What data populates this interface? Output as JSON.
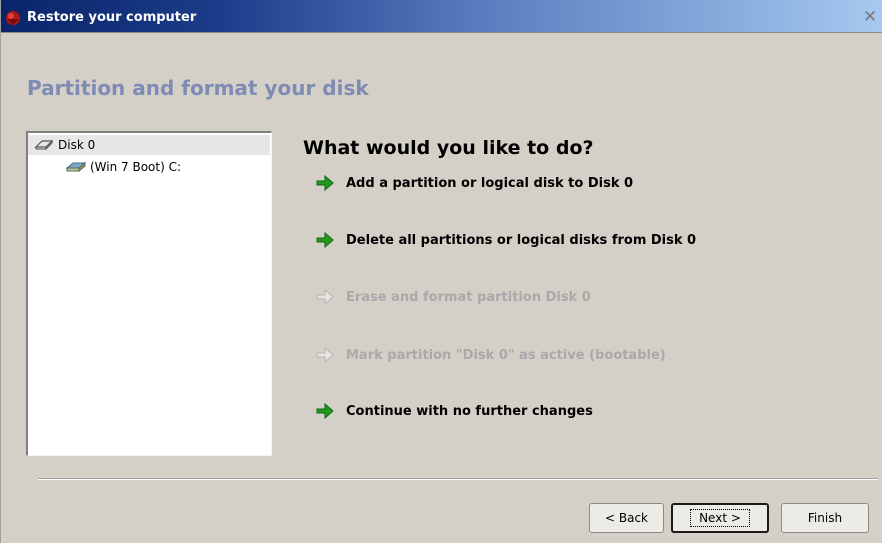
{
  "window": {
    "title": "Restore your computer",
    "close_glyph": "✕"
  },
  "page": {
    "title": "Partition and format your disk",
    "question": "What would you like to do?"
  },
  "tree": {
    "items": [
      {
        "label": "Disk 0",
        "icon": "disk-icon",
        "selected": true
      },
      {
        "label": "(Win 7 Boot) C:",
        "icon": "partition-icon",
        "selected": false
      }
    ]
  },
  "options": [
    {
      "label": "Add a partition or logical disk to Disk 0",
      "enabled": true
    },
    {
      "label": "Delete all partitions or logical disks from Disk 0",
      "enabled": true
    },
    {
      "label": "Erase and format partition Disk 0",
      "enabled": false
    },
    {
      "label": "Mark partition \"Disk 0\" as active (bootable)",
      "enabled": false
    },
    {
      "label": "Continue with no further changes",
      "enabled": true
    }
  ],
  "buttons": {
    "back": "< Back",
    "next": "Next >",
    "finish": "Finish"
  },
  "colors": {
    "enabled_arrow": "#1f9a1f",
    "disabled_arrow": "#c8c8c8",
    "title_accent": "#7e8bb5"
  }
}
